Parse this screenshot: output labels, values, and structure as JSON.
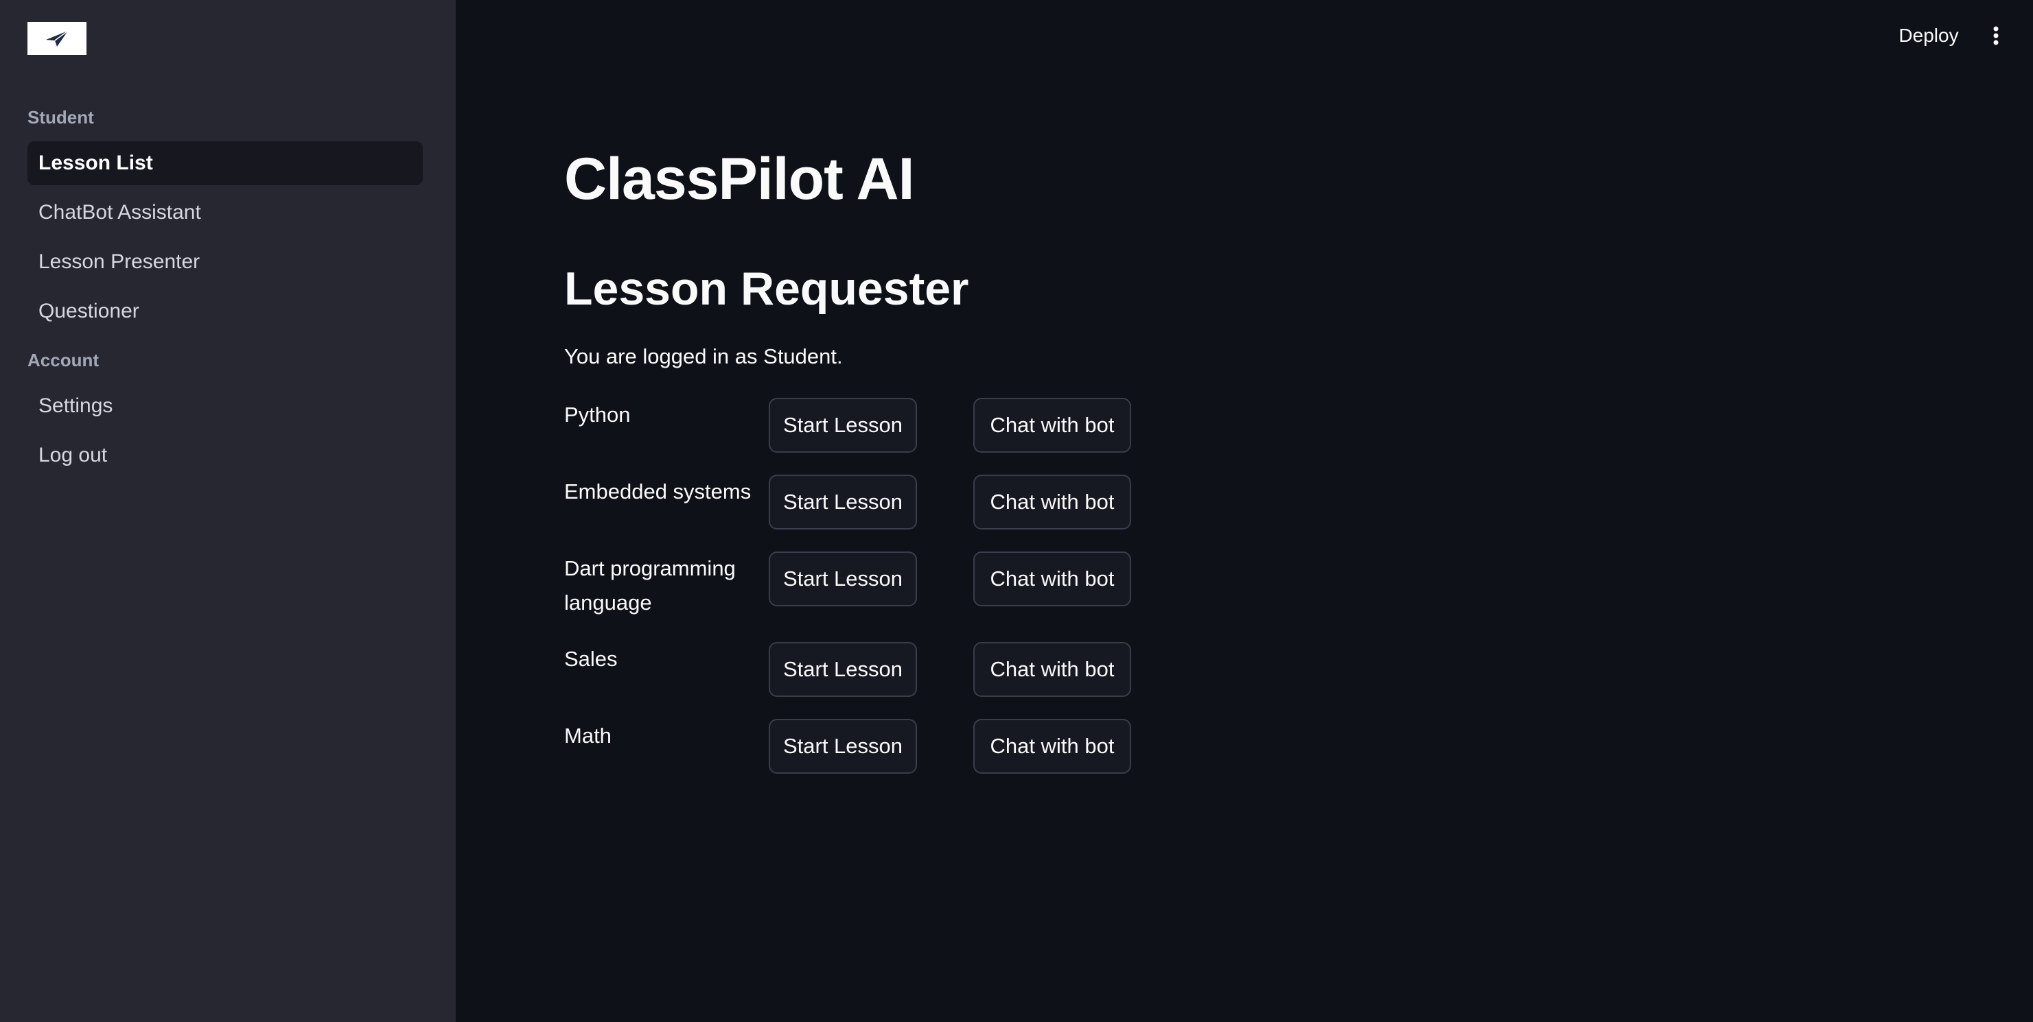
{
  "sidebar": {
    "logo_icon": "paper-plane-icon",
    "sections": [
      {
        "label": "Student",
        "items": [
          {
            "label": "Lesson List",
            "active": true
          },
          {
            "label": "ChatBot Assistant",
            "active": false
          },
          {
            "label": "Lesson Presenter",
            "active": false
          },
          {
            "label": "Questioner",
            "active": false
          }
        ]
      },
      {
        "label": "Account",
        "items": [
          {
            "label": "Settings",
            "active": false
          },
          {
            "label": "Log out",
            "active": false
          }
        ]
      }
    ]
  },
  "header": {
    "deploy_label": "Deploy",
    "menu_icon": "kebab-menu-icon"
  },
  "main": {
    "title": "ClassPilot AI",
    "subtitle": "Lesson Requester",
    "status": "You are logged in as Student.",
    "lessons": [
      {
        "name": "Python",
        "start_label": "Start Lesson",
        "chat_label": "Chat with bot"
      },
      {
        "name": "Embedded systems",
        "start_label": "Start Lesson",
        "chat_label": "Chat with bot"
      },
      {
        "name": "Dart programming language",
        "start_label": "Start Lesson",
        "chat_label": "Chat with bot"
      },
      {
        "name": "Sales",
        "start_label": "Start Lesson",
        "chat_label": "Chat with bot"
      },
      {
        "name": "Math",
        "start_label": "Start Lesson",
        "chat_label": "Chat with bot"
      }
    ]
  },
  "colors": {
    "background": "#0e1117",
    "sidebar": "#262730",
    "active_item": "#16171f",
    "button_border": "#3a3d4a",
    "text": "#fafafa"
  }
}
